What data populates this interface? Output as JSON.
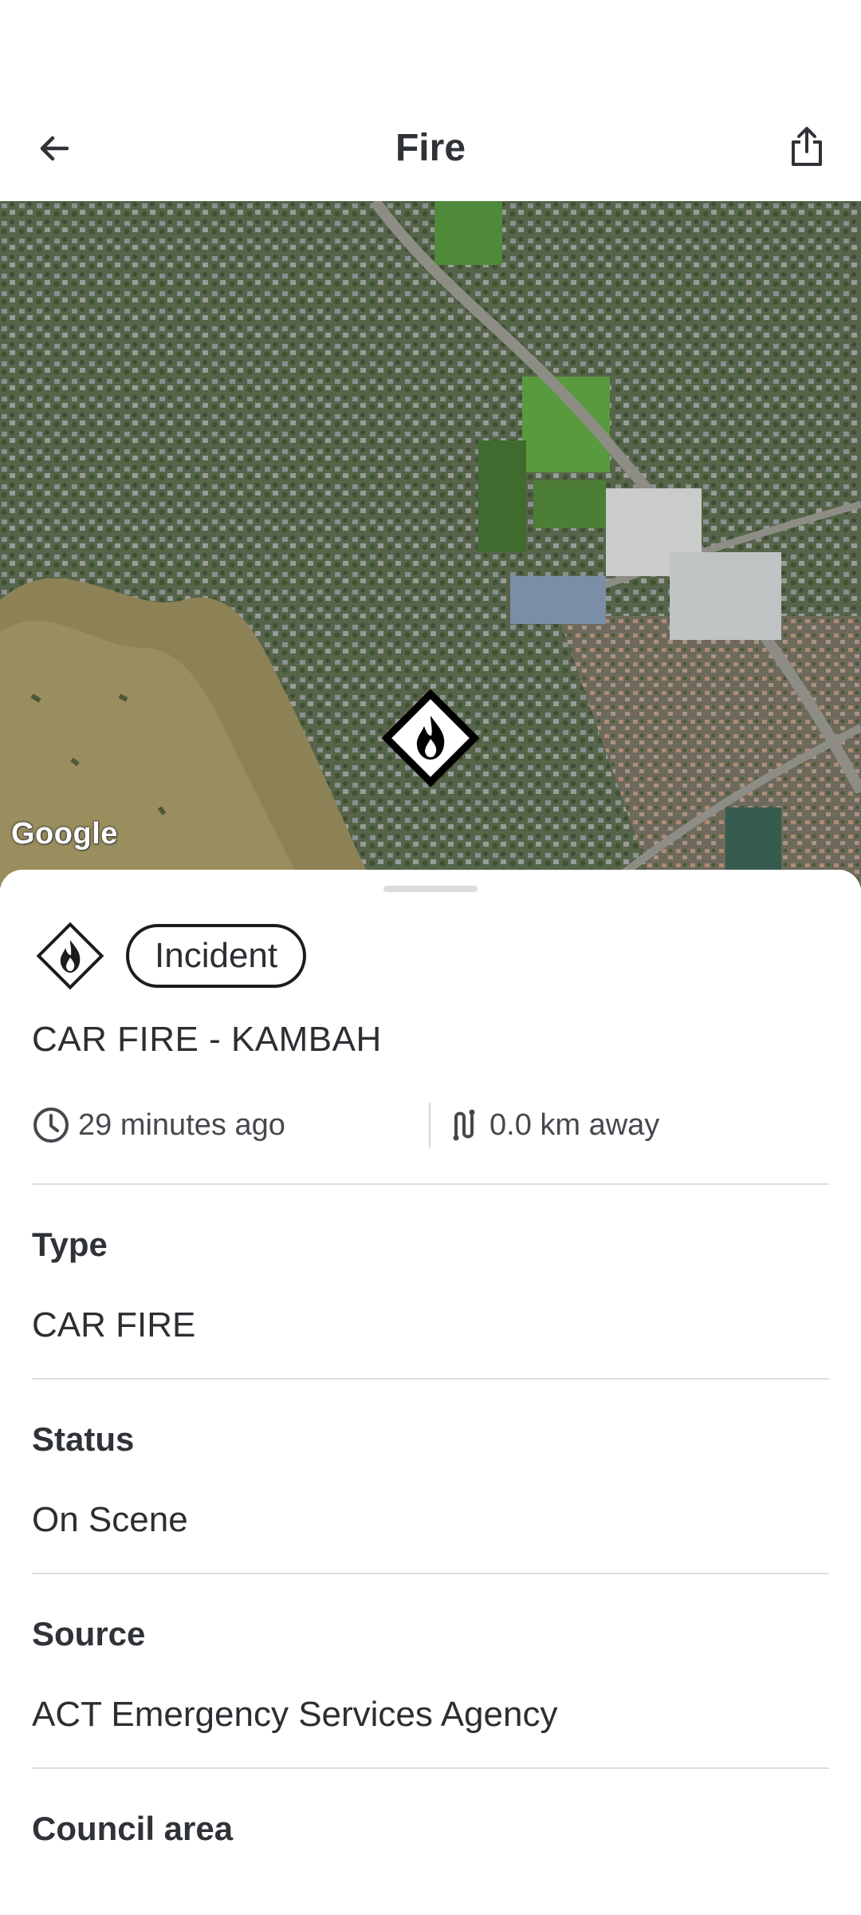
{
  "appbar": {
    "title": "Fire",
    "back_icon": "arrow-left-icon",
    "share_icon": "share-icon"
  },
  "map": {
    "attribution": "Google",
    "marker_icon": "fire-diamond-icon"
  },
  "sheet": {
    "badge_icon": "fire-diamond-icon",
    "chip_label": "Incident",
    "title": "CAR FIRE - KAMBAH",
    "time_ago": "29 minutes ago",
    "distance": "0.0 km away",
    "fields": [
      {
        "label": "Type",
        "value": "CAR FIRE"
      },
      {
        "label": "Status",
        "value": "On Scene"
      },
      {
        "label": "Source",
        "value": "ACT Emergency Services Agency"
      },
      {
        "label": "Council area",
        "value": ""
      }
    ]
  },
  "colors": {
    "text": "#2b2f33",
    "divider": "#dedede",
    "marker": "#000000"
  }
}
